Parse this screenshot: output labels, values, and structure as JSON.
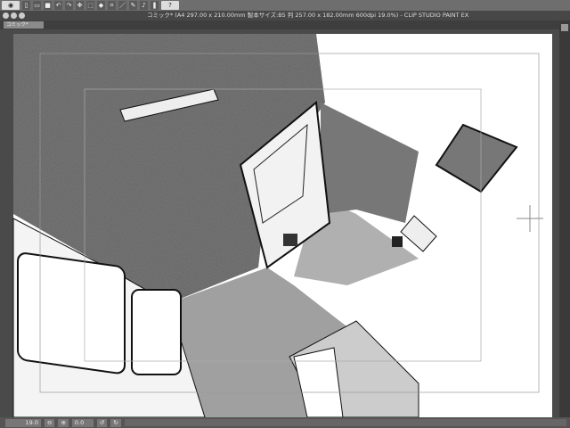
{
  "toolbar": {
    "items": [
      "view-icon",
      "new-icon",
      "open-icon",
      "save-icon",
      "undo-icon",
      "redo-icon",
      "transform-icon",
      "select-icon",
      "fill-icon",
      "crop-icon",
      "ruler-icon",
      "pen-icon",
      "brush-icon",
      "help-icon"
    ]
  },
  "window": {
    "title": "コミック* (A4 297.00 x 210.00mm 製本サイズ:B5 判 257.00 x 182.00mm 600dpi 19.0%)  - CLIP STUDIO PAINT EX"
  },
  "tabs": [
    {
      "label": "コミック*"
    }
  ],
  "status": {
    "zoom": "19.0",
    "rotation": "0.0"
  },
  "colors": {
    "toolbar": "#6e6e6e",
    "titlebar": "#474747",
    "canvas_bg": "#4a4a4a"
  }
}
